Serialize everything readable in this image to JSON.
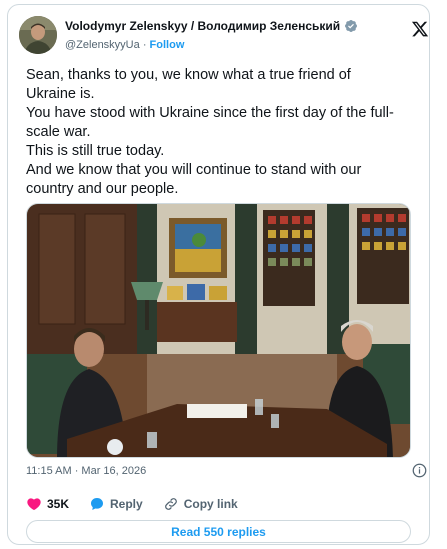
{
  "author": {
    "name": "Volodymyr Zelenskyy / Володимир Зеленський",
    "handle": "@ZelenskyyUa",
    "separator": "·",
    "follow_label": "Follow",
    "verified_color": "#829aab"
  },
  "tweet": {
    "lines": [
      "Sean, thanks to you, we know what a true friend of",
      "Ukraine is.",
      "You have stood with Ukraine since the first day of the full-",
      "scale war.",
      "This is still true today.",
      "And we know that you will continue to stand with our",
      "country and our people."
    ],
    "timestamp": "11:15 AM · Mar 16, 2026"
  },
  "actions": {
    "like_count": "35K",
    "reply_label": "Reply",
    "copy_link_label": "Copy link",
    "read_replies_label": "Read 550 replies"
  },
  "colors": {
    "accent": "#1d9bf0",
    "like": "#f91880",
    "muted_text": "#536471",
    "border": "#cfd9de"
  },
  "icons": {
    "brand": "x-logo-icon",
    "verified": "verified-badge-icon",
    "info": "info-icon",
    "like": "heart-icon",
    "reply": "speech-bubble-icon",
    "copy_link": "link-icon"
  }
}
